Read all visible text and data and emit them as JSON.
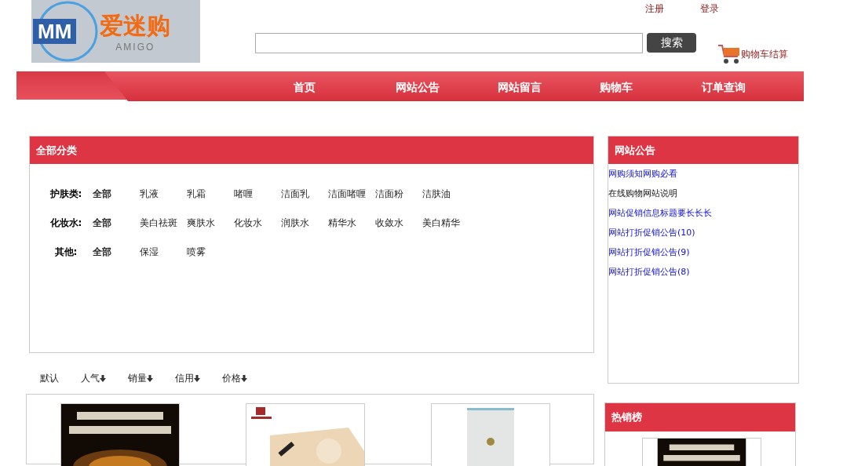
{
  "logo": {
    "mark": "MM",
    "name": "爱迷购",
    "sub": "AMIGO"
  },
  "account_links": [
    "注册",
    "登录"
  ],
  "search": {
    "button": "搜索"
  },
  "cart_link": "购物车结算",
  "nav": [
    {
      "label": "首页"
    },
    {
      "label": "网站公告"
    },
    {
      "label": "网站留言"
    },
    {
      "label": "购物车"
    },
    {
      "label": "订单查询"
    }
  ],
  "categories": {
    "title": "全部分类",
    "groups": [
      {
        "label": "护肤类:",
        "items": [
          {
            "label": "全部",
            "selected": true
          },
          {
            "label": "乳液",
            "selected": false
          },
          {
            "label": "乳霜",
            "selected": false
          },
          {
            "label": "啫喱",
            "selected": false
          },
          {
            "label": "洁面乳",
            "selected": false
          },
          {
            "label": "洁面啫喱",
            "selected": false
          },
          {
            "label": "洁面粉",
            "selected": false
          },
          {
            "label": "洁肤油",
            "selected": false
          }
        ]
      },
      {
        "label": "化妆水:",
        "items": [
          {
            "label": "全部",
            "selected": true
          },
          {
            "label": "美白祛斑",
            "selected": false
          },
          {
            "label": "爽肤水",
            "selected": false
          },
          {
            "label": "化妆水",
            "selected": false
          },
          {
            "label": "润肤水",
            "selected": false
          },
          {
            "label": "精华水",
            "selected": false
          },
          {
            "label": "收敛水",
            "selected": false
          },
          {
            "label": "美白精华",
            "selected": false
          }
        ]
      },
      {
        "label": "其他:",
        "items": [
          {
            "label": "全部",
            "selected": true
          },
          {
            "label": "保湿",
            "selected": false
          },
          {
            "label": "喷雾",
            "selected": false
          }
        ]
      }
    ]
  },
  "sort": [
    {
      "label": "默认",
      "arrow": false
    },
    {
      "label": "人气",
      "arrow": true
    },
    {
      "label": "销量",
      "arrow": true
    },
    {
      "label": "信用",
      "arrow": true
    },
    {
      "label": "价格",
      "arrow": true
    }
  ],
  "products": [
    {
      "kind": "picture"
    },
    {
      "kind": "picture"
    },
    {
      "kind": "picture"
    }
  ],
  "notices": {
    "title": "网站公告",
    "items": [
      {
        "label": "网购须知网购必看",
        "visited": false
      },
      {
        "label": "在线购物网站说明",
        "visited": true
      },
      {
        "label": "网站促销信息标题要长长长",
        "visited": false
      },
      {
        "label": "网站打折促销公告(10)",
        "visited": false
      },
      {
        "label": "网站打折促销公告(9)",
        "visited": false
      },
      {
        "label": "网站打折促销公告(8)",
        "visited": false
      }
    ]
  },
  "hot": {
    "title": "热销榜",
    "items": [
      {
        "kind": "picture"
      }
    ]
  }
}
